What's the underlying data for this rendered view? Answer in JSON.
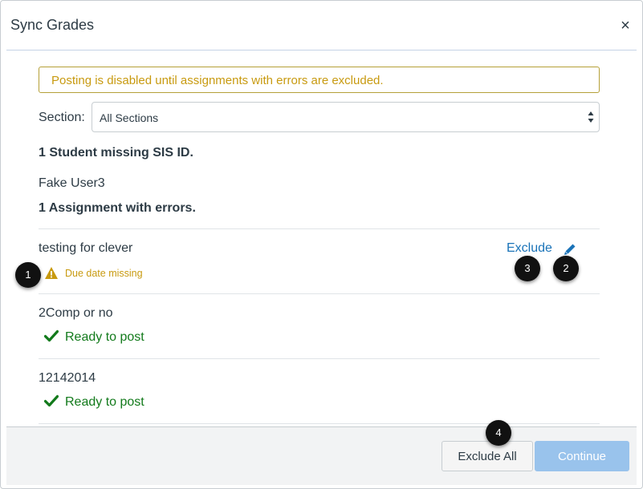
{
  "dialog": {
    "title": "Sync Grades",
    "close_glyph": "×",
    "close_icon": "close-icon"
  },
  "banner": {
    "message": "Posting is disabled until assignments with errors are excluded.",
    "border_color": "#b5a038",
    "text_color": "#c89a10"
  },
  "section": {
    "label": "Section:",
    "selected": "All Sections",
    "arrow_icon": "updown-arrows-icon"
  },
  "students": {
    "heading": "1 Student missing SIS ID.",
    "items": [
      "Fake User3"
    ]
  },
  "assignments": {
    "heading": "1 Assignment with errors.",
    "items": [
      {
        "name": "testing for clever",
        "status": "Due date missing",
        "status_type": "warning",
        "status_icon": "warning-icon",
        "exclude_label": "Exclude",
        "edit_icon": "pencil-icon"
      },
      {
        "name": "2Comp or no",
        "status": "Ready to post",
        "status_type": "ready",
        "status_icon": "checkmark-icon"
      },
      {
        "name": "12142014",
        "status": "Ready to post",
        "status_type": "ready",
        "status_icon": "checkmark-icon"
      }
    ]
  },
  "callouts": [
    "1",
    "2",
    "3",
    "4"
  ],
  "footer": {
    "exclude_all_label": "Exclude All",
    "continue_label": "Continue",
    "continue_disabled": true
  },
  "colors": {
    "link": "#1a73b8",
    "ready": "#127a1b",
    "warning": "#c89a10",
    "primary_disabled": "#99c3ec"
  }
}
